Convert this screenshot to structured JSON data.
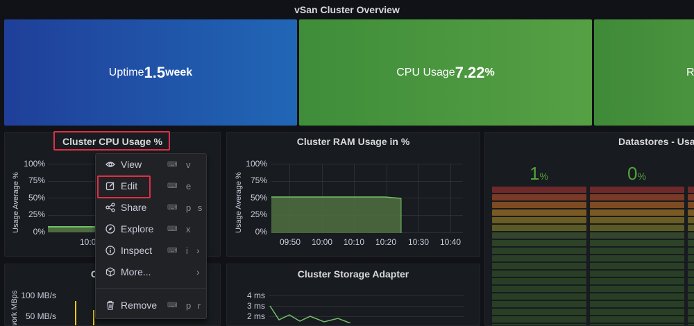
{
  "row": {
    "title": "vSan Cluster Overview"
  },
  "stats": [
    {
      "label": "Uptime",
      "value": "1.5",
      "unit": " week",
      "color": "#1f4ba0"
    },
    {
      "label": "CPU Usage",
      "value": "7.22",
      "unit": "%",
      "color": "#4a9140"
    },
    {
      "label": "R",
      "value": "",
      "unit": "",
      "color": "#458c3c"
    }
  ],
  "cpu_panel": {
    "title": "Cluster CPU Usage %",
    "y_axis_title": "Usage Average %",
    "y_ticks": [
      "100%",
      "75%",
      "50%",
      "25%",
      "0%"
    ],
    "x_ticks": [
      "10:0"
    ]
  },
  "ram_panel": {
    "title": "Cluster RAM Usage in %",
    "y_axis_title": "Usage Average %",
    "y_ticks": [
      "100%",
      "75%",
      "50%",
      "25%",
      "0%"
    ],
    "x_ticks": [
      "09:50",
      "10:00",
      "10:10",
      "10:20",
      "10:30",
      "10:40"
    ]
  },
  "datastores_panel": {
    "title": "Datastores - Usag",
    "values": [
      {
        "value": "1",
        "unit": "%"
      },
      {
        "value": "0",
        "unit": "%"
      }
    ]
  },
  "network_panel": {
    "title": "Cluster N",
    "y_axis_title": "work MBps",
    "y_ticks": [
      "100 MB/s",
      "50 MB/s"
    ]
  },
  "storage_panel": {
    "title": "Cluster Storage Adapter",
    "y_ticks": [
      "4 ms",
      "3 ms",
      "2 ms"
    ]
  },
  "context_menu": {
    "items": [
      {
        "label": "View",
        "icon": "eye-icon",
        "key": "v"
      },
      {
        "label": "Edit",
        "icon": "edit-icon",
        "key": "e"
      },
      {
        "label": "Share",
        "icon": "share-icon",
        "key": "p s"
      },
      {
        "label": "Explore",
        "icon": "compass-icon",
        "key": "x"
      },
      {
        "label": "Inspect",
        "icon": "info-icon",
        "key": "i"
      },
      {
        "label": "More...",
        "icon": "cube-icon",
        "key": ""
      },
      {
        "label": "Remove",
        "icon": "trash-icon",
        "key": "p r"
      }
    ]
  },
  "colors": {
    "highlight": "#e02f44",
    "series_green": "#73bf69",
    "background": "#111217"
  }
}
